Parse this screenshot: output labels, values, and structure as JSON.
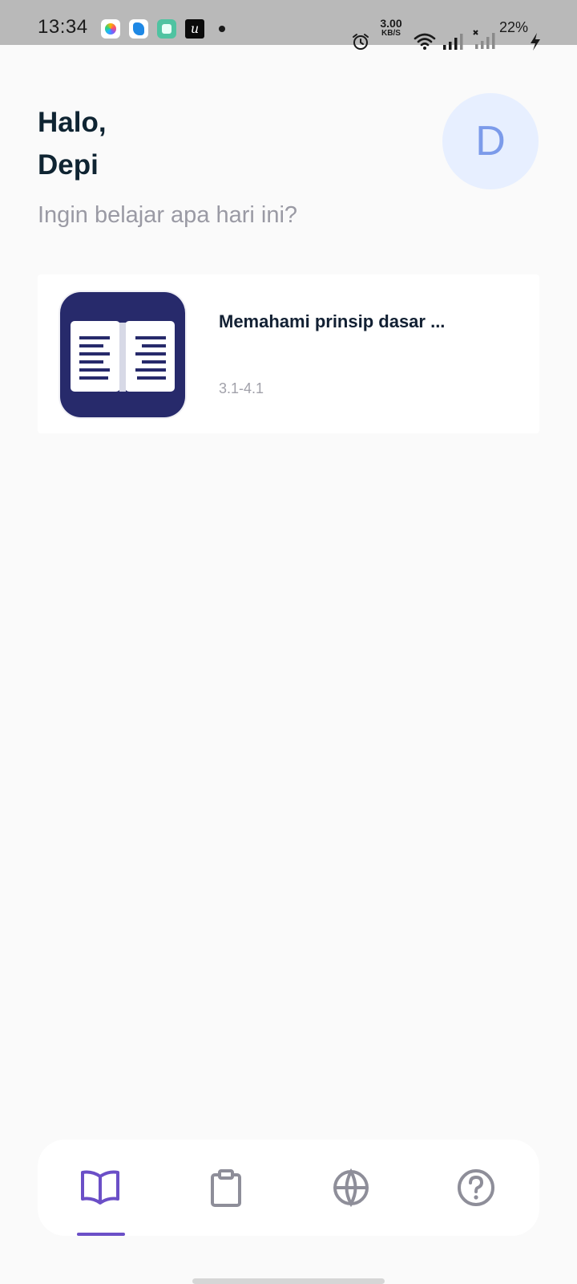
{
  "status_bar": {
    "time": "13:34",
    "net_speed_value": "3.00",
    "net_speed_unit": "KB/S",
    "battery": "22%",
    "icons": [
      "app-star-icon",
      "app-blue-icon",
      "app-green-icon",
      "app-u-icon",
      "notification-dot-icon",
      "alarm-icon",
      "wifi-icon",
      "signal-icon",
      "signal-no-service-icon",
      "charging-bolt-icon"
    ]
  },
  "header": {
    "greeting_line1": "Halo,",
    "greeting_line2": "Depi",
    "subtitle": "Ingin belajar apa hari ini?",
    "avatar_initial": "D"
  },
  "courses": [
    {
      "title": "Memahami prinsip dasar  ...",
      "code": "3.1-4.1",
      "icon": "open-book-icon"
    }
  ],
  "bottom_nav": {
    "items": [
      {
        "icon": "book-icon",
        "active": true
      },
      {
        "icon": "clipboard-icon",
        "active": false
      },
      {
        "icon": "globe-icon",
        "active": false
      },
      {
        "icon": "help-icon",
        "active": false
      }
    ],
    "active_color": "#6b4fc7",
    "inactive_color": "#8e8e99"
  },
  "colors": {
    "background": "#fafafa",
    "status_bar": "#b9b9b9",
    "avatar_bg": "#e7efff",
    "avatar_text": "#7c9bea",
    "course_icon_bg": "#272a6b"
  }
}
